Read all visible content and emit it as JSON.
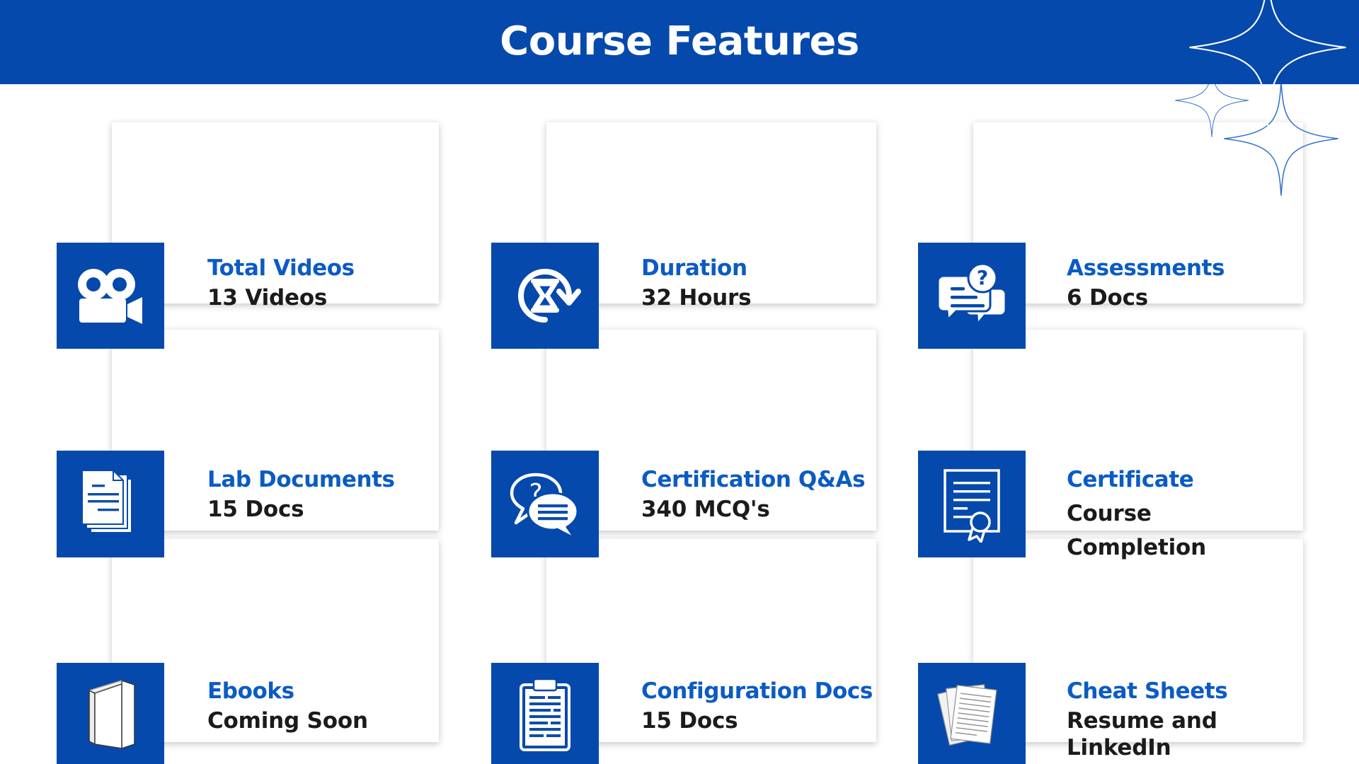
{
  "header": {
    "title": "Course Features",
    "background_color": "#0549ac",
    "title_color": "#ffffff"
  },
  "theme": {
    "accent_blue": "#0549ac",
    "title_blue": "#0b5bc4",
    "value_dark": "#1b1b1b",
    "page_background": "#ffffff"
  },
  "decorations": [
    {
      "name": "sparkle-large-top",
      "stroke": "#ffffff"
    },
    {
      "name": "sparkle-small",
      "stroke": "#2f6fd0"
    },
    {
      "name": "sparkle-large-bottom",
      "stroke": "#2f6fd0"
    }
  ],
  "cards": [
    {
      "icon": "video-camera-icon",
      "title": "Total Videos",
      "value": "13 Videos"
    },
    {
      "icon": "hourglass-clock-icon",
      "title": "Duration",
      "value": "32 Hours"
    },
    {
      "icon": "question-chat-icon",
      "title": "Assessments",
      "value": "6 Docs"
    },
    {
      "icon": "documents-stack-icon",
      "title": "Lab Documents",
      "value": "15 Docs"
    },
    {
      "icon": "chat-bubbles-icon",
      "title": "Certification Q&As",
      "value": "340 MCQ's"
    },
    {
      "icon": "certificate-icon",
      "title": "Certificate",
      "value": "Course Completion"
    },
    {
      "icon": "book-icon",
      "title": "Ebooks",
      "value": "Coming Soon"
    },
    {
      "icon": "clipboard-icon",
      "title": "Configuration Docs",
      "value": "15 Docs"
    },
    {
      "icon": "papers-stack-icon",
      "title": "Cheat Sheets",
      "value": "Resume and LinkedIn"
    }
  ]
}
